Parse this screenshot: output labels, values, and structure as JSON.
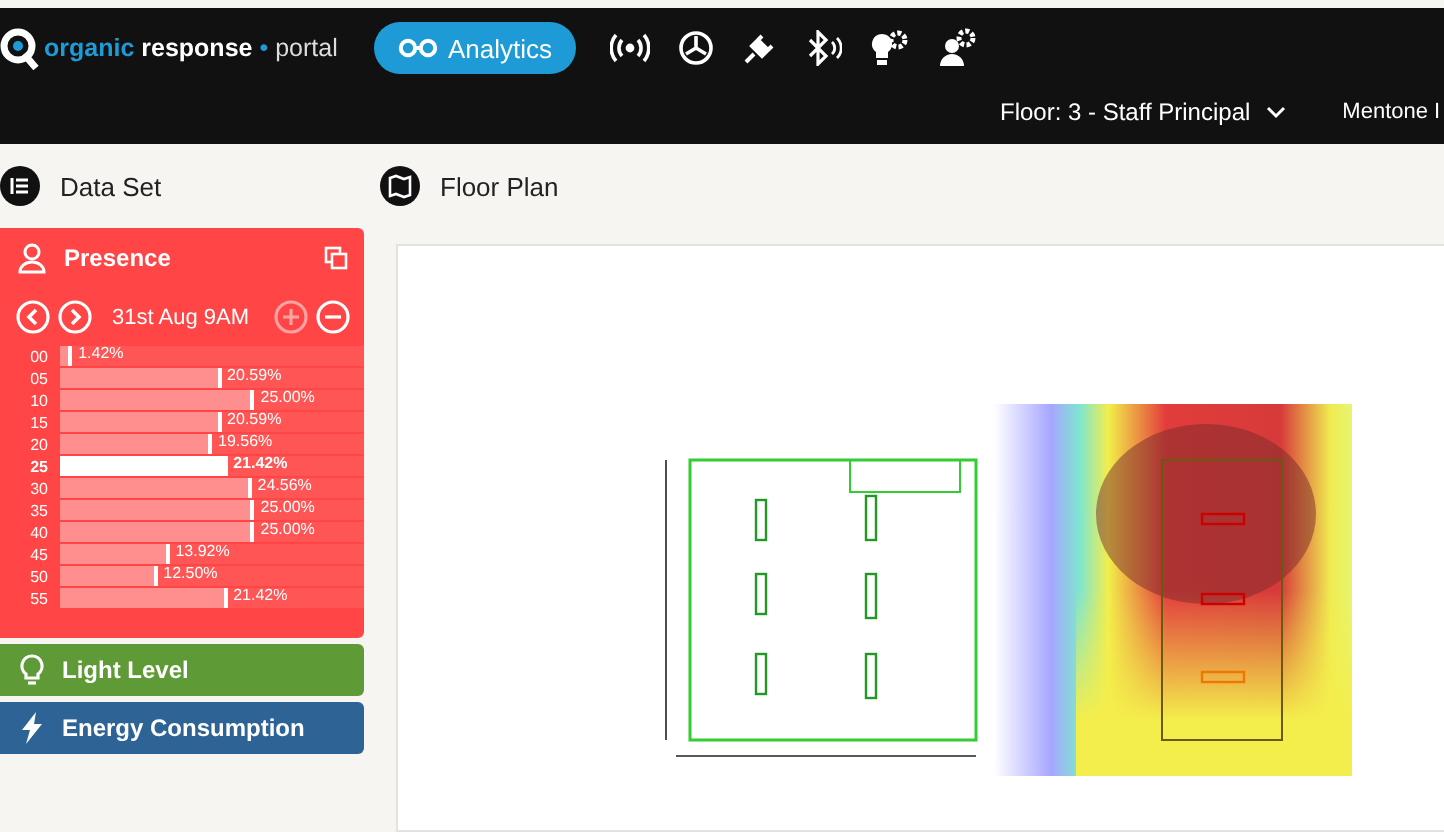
{
  "header": {
    "logo_brand": "organic",
    "logo_main": "response",
    "logo_separator": "•",
    "logo_sub": "portal",
    "analytics_button": "Analytics",
    "floor_selector": "Floor: 3 - Staff Principal",
    "site": "Mentone I"
  },
  "data_set": {
    "title": "Data Set"
  },
  "presence": {
    "title": "Presence",
    "date": "31st Aug 9AM",
    "rows": [
      {
        "label": "00",
        "value": "1.42%",
        "level": 0.04,
        "selected": false
      },
      {
        "label": "05",
        "value": "20.59%",
        "level": 0.53,
        "selected": false
      },
      {
        "label": "10",
        "value": "25.00%",
        "level": 0.64,
        "selected": false
      },
      {
        "label": "15",
        "value": "20.59%",
        "level": 0.53,
        "selected": false
      },
      {
        "label": "20",
        "value": "19.56%",
        "level": 0.5,
        "selected": false
      },
      {
        "label": "25",
        "value": "21.42%",
        "level": 0.55,
        "selected": true
      },
      {
        "label": "30",
        "value": "24.56%",
        "level": 0.63,
        "selected": false
      },
      {
        "label": "35",
        "value": "25.00%",
        "level": 0.64,
        "selected": false
      },
      {
        "label": "40",
        "value": "25.00%",
        "level": 0.64,
        "selected": false
      },
      {
        "label": "45",
        "value": "13.92%",
        "level": 0.36,
        "selected": false
      },
      {
        "label": "50",
        "value": "12.50%",
        "level": 0.32,
        "selected": false
      },
      {
        "label": "55",
        "value": "21.42%",
        "level": 0.55,
        "selected": false
      }
    ]
  },
  "sections": [
    {
      "kind": "light",
      "title": "Light Level"
    },
    {
      "kind": "energy",
      "title": "Energy Consumption"
    }
  ],
  "floor_plan": {
    "title": "Floor Plan"
  }
}
